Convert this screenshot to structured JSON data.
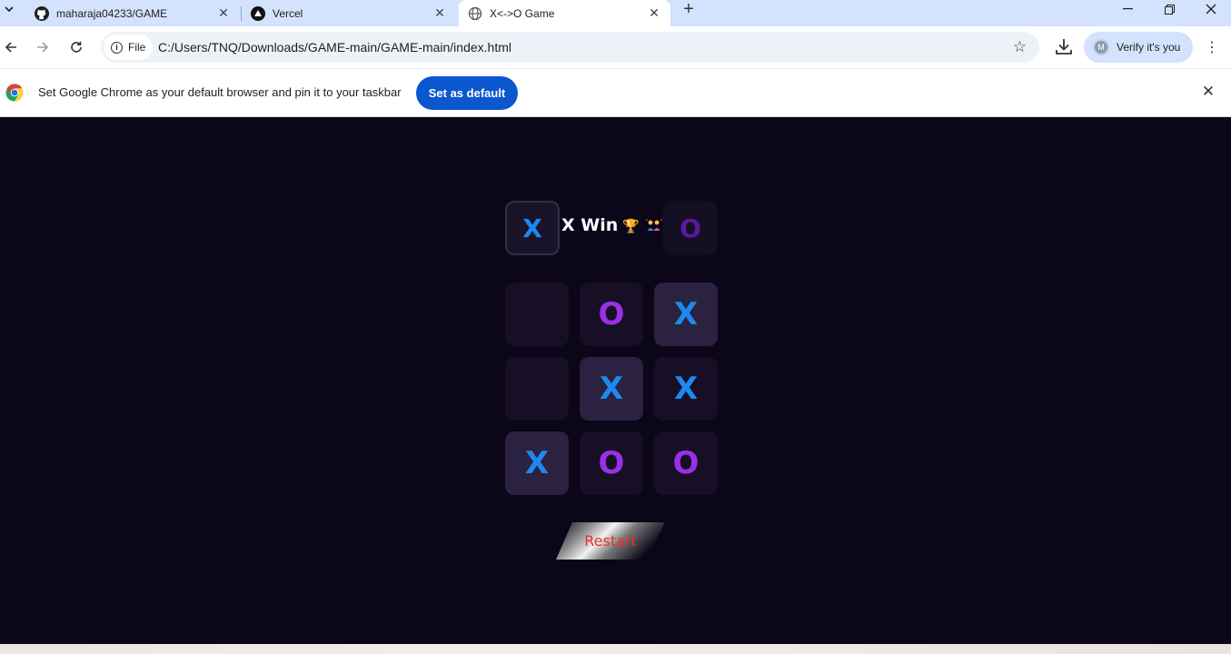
{
  "browser": {
    "tabs": [
      {
        "title": "maharaja04233/GAME",
        "icon": "github-icon",
        "active": false
      },
      {
        "title": "Vercel",
        "icon": "vercel-icon",
        "active": false
      },
      {
        "title": "X<->O Game",
        "icon": "globe-icon",
        "active": true
      }
    ],
    "address": {
      "chip_label": "File",
      "url": "C:/Users/TNQ/Downloads/GAME-main/GAME-main/index.html"
    },
    "profile_label": "Verify it's you",
    "profile_initial": "M"
  },
  "infobar": {
    "message": "Set Google Chrome as your default browser and pin it to your taskbar",
    "button_label": "Set as default"
  },
  "game": {
    "turn_x": "X",
    "turn_o": "O",
    "status": "X Win",
    "trophy": "🏆",
    "board": [
      {
        "mark": "",
        "highlight": false
      },
      {
        "mark": "O",
        "highlight": false
      },
      {
        "mark": "X",
        "highlight": true
      },
      {
        "mark": "",
        "highlight": false
      },
      {
        "mark": "X",
        "highlight": true
      },
      {
        "mark": "X",
        "highlight": false
      },
      {
        "mark": "X",
        "highlight": true
      },
      {
        "mark": "O",
        "highlight": false
      },
      {
        "mark": "O",
        "highlight": false
      }
    ],
    "restart_label": "Restart",
    "colors": {
      "x": "#1e88f0",
      "o": "#9b2fe6",
      "background": "#0b0618",
      "restart_text": "#e8322b"
    }
  }
}
